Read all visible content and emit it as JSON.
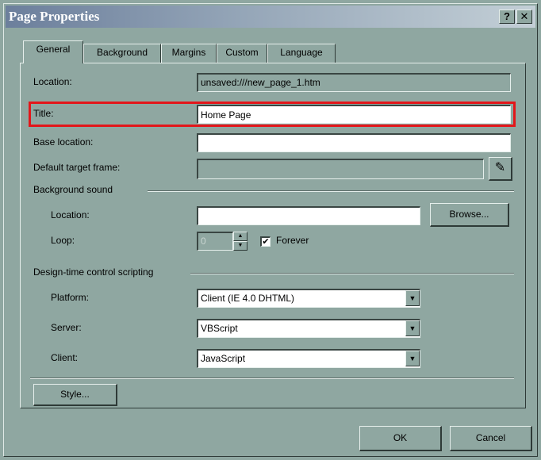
{
  "window": {
    "title": "Page Properties",
    "help_button": "?",
    "close_button": "✕"
  },
  "tabs": [
    {
      "label": "General",
      "active": true
    },
    {
      "label": "Background"
    },
    {
      "label": "Margins"
    },
    {
      "label": "Custom"
    },
    {
      "label": "Language"
    }
  ],
  "general": {
    "location_label": "Location:",
    "location_value": "unsaved:///new_page_1.htm",
    "title_label": "Title:",
    "title_value": "Home Page",
    "base_location_label": "Base location:",
    "base_location_value": "",
    "default_target_label": "Default target frame:",
    "default_target_value": ""
  },
  "background_sound": {
    "group_label": "Background sound",
    "location_label": "Location:",
    "location_value": "",
    "browse_button": "Browse...",
    "loop_label": "Loop:",
    "loop_value": "0",
    "forever_label": "Forever",
    "forever_checked": "✔"
  },
  "design_time": {
    "group_label": "Design-time control scripting",
    "platform_label": "Platform:",
    "platform_value": "Client (IE 4.0 DHTML)",
    "server_label": "Server:",
    "server_value": "VBScript",
    "client_label": "Client:",
    "client_value": "JavaScript"
  },
  "buttons": {
    "style": "Style...",
    "ok": "OK",
    "cancel": "Cancel"
  },
  "colors": {
    "dialog_bg": "#8fa7a1",
    "highlight": "#e3161a"
  }
}
